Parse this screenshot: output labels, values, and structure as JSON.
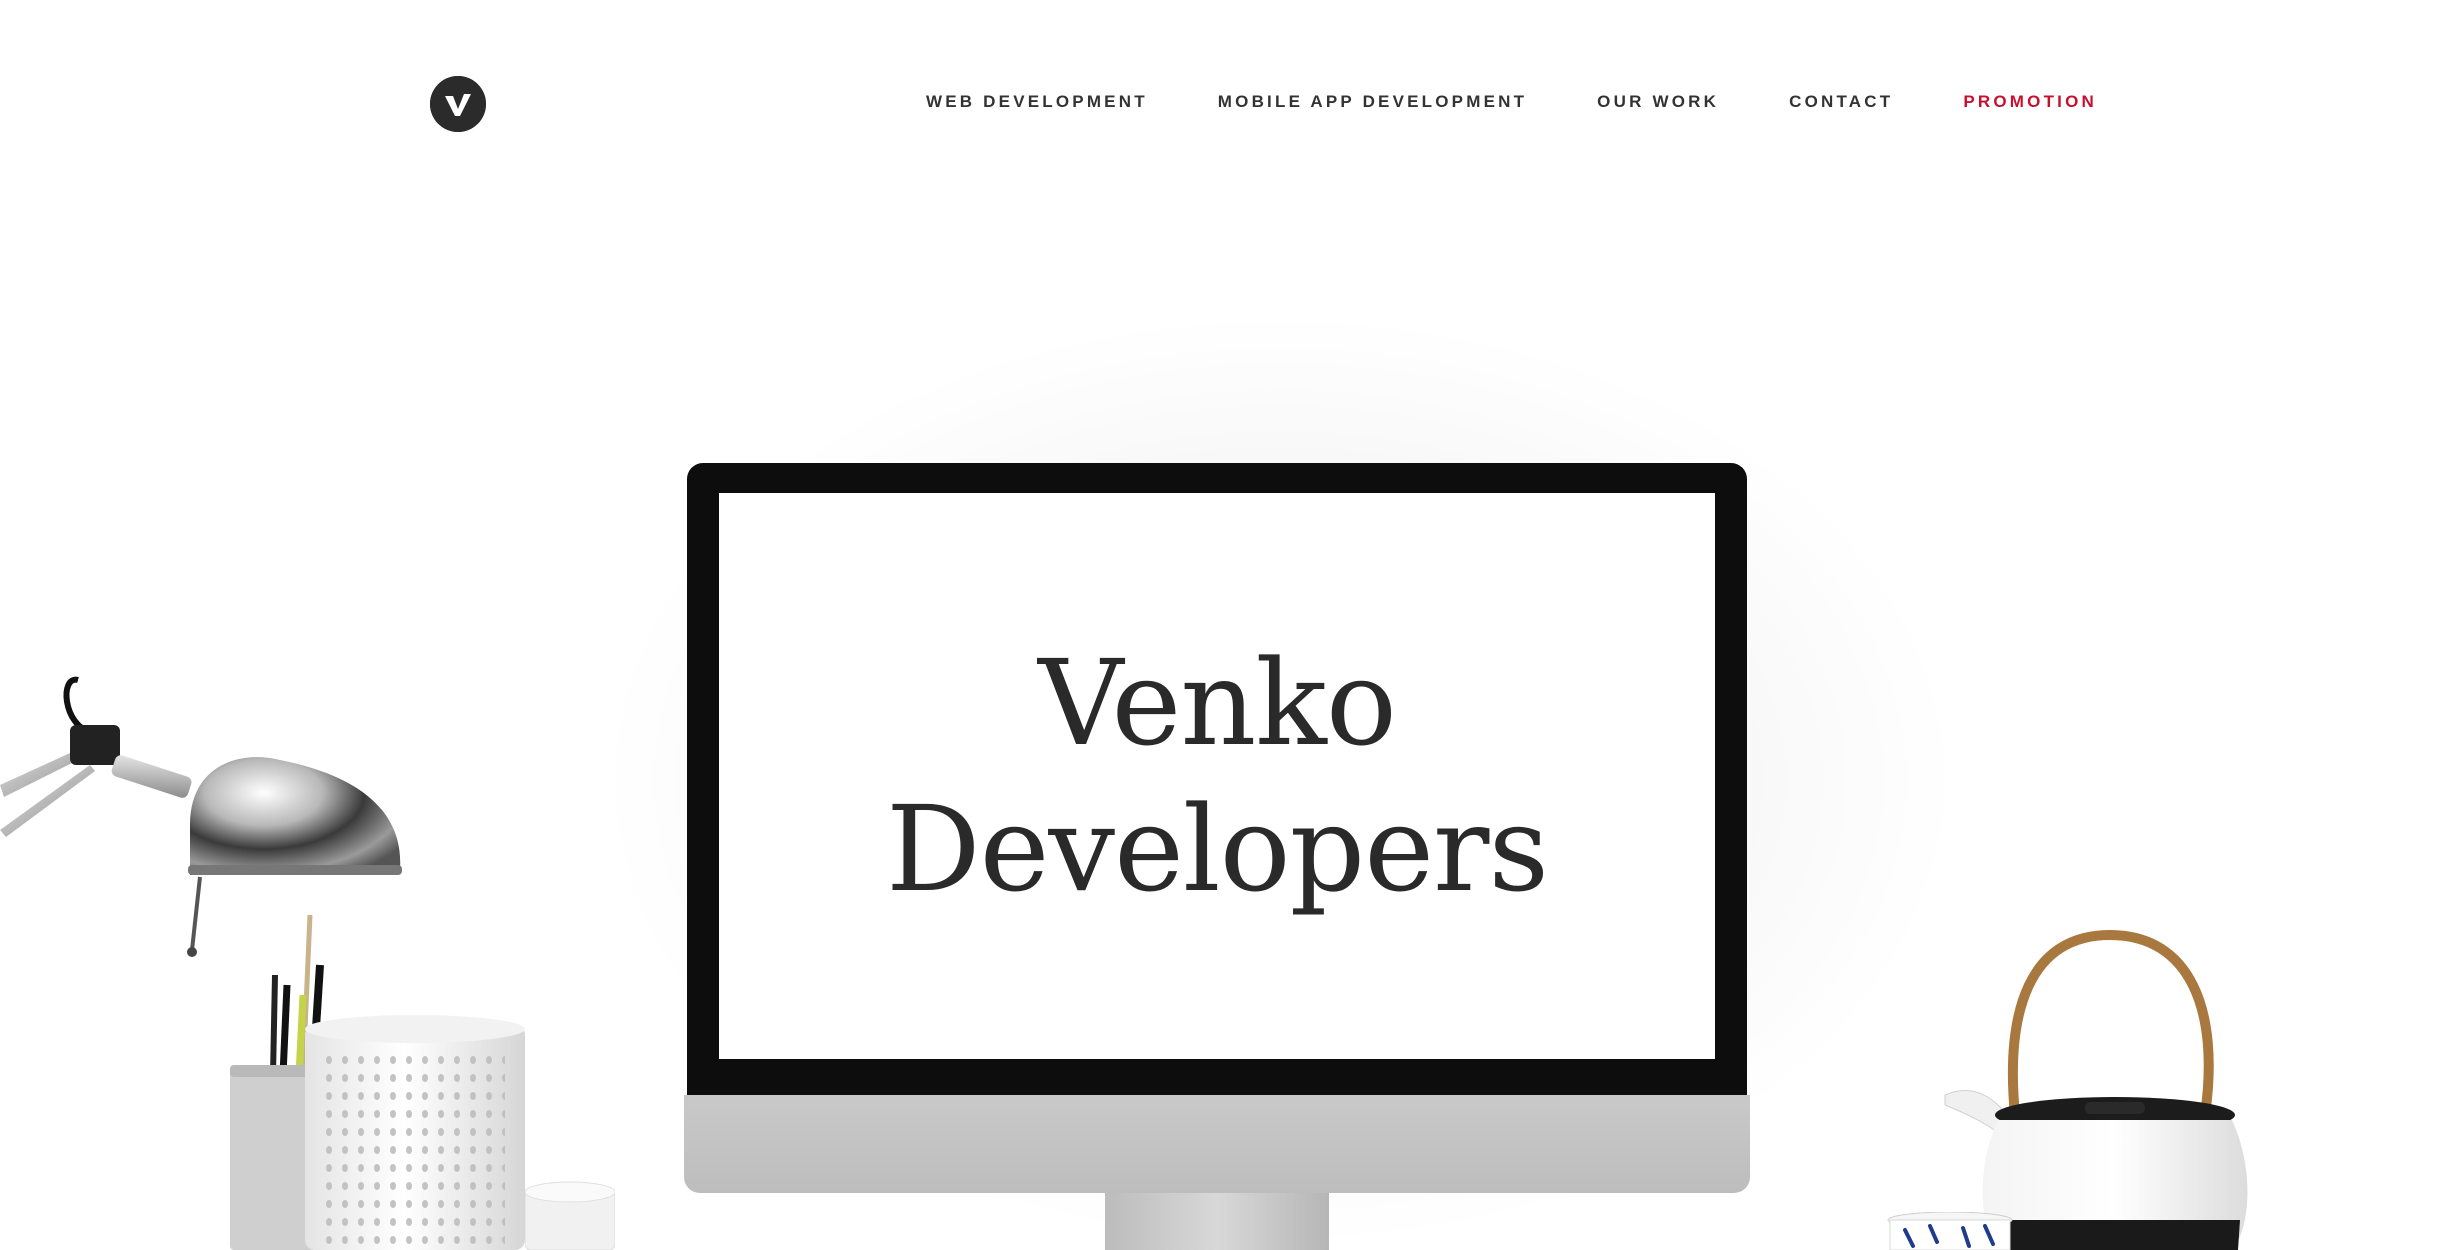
{
  "brand": {
    "logo_icon": "venko-v-logo-icon",
    "logo_bg": "#2b2b2b"
  },
  "nav": {
    "items": [
      {
        "label": "WEB DEVELOPMENT"
      },
      {
        "label": "MOBILE APP DEVELOPMENT"
      },
      {
        "label": "OUR WORK"
      },
      {
        "label": "CONTACT"
      },
      {
        "label": "PROMOTION",
        "accent": "#c8102e"
      }
    ]
  },
  "hero": {
    "title_line1": "Venko",
    "title_line2": "Developers"
  },
  "colors": {
    "text": "#333333",
    "accent": "#c8102e",
    "monitor_bezel": "#0d0d0d"
  },
  "decor": {
    "left": [
      "desk-lamp-icon",
      "pencil-cup-icon",
      "perforated-vase-icon"
    ],
    "right": [
      "teapot-icon",
      "teacup-icon"
    ]
  }
}
